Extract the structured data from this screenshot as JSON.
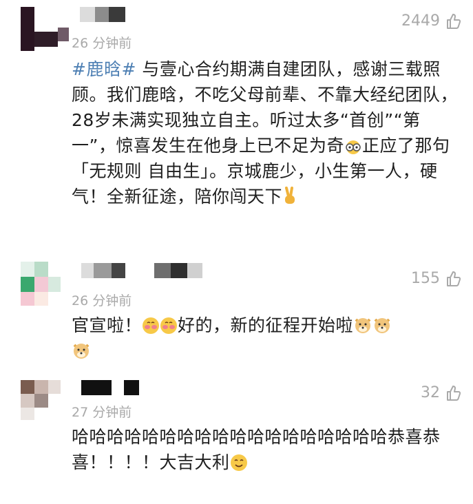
{
  "comments": [
    {
      "time": "26 分钟前",
      "likes": "2449",
      "hashtag": "#鹿晗#",
      "text": " 与壹心合约期满自建团队，感谢三载照顾。我们鹿晗，不吃父母前辈、不靠大经纪团队，28岁未满实现独立自主。听过太多“首创”“第一”，惊喜发生在他身上已不足为奇",
      "text2": "正应了那句「无规则 自由生」。京城鹿少，小生第一人，硬气！全新征途，陪你闯天下",
      "emojis": [
        "glasses-emoji",
        "victory-hand-emoji"
      ]
    },
    {
      "time": "26 分钟前",
      "likes": "155",
      "text": "官宣啦！",
      "text2": "好的，新的征程开始啦",
      "emojis": [
        "blush-emoji",
        "blush-emoji",
        "doge-emoji",
        "doge-emoji",
        "doge-emoji"
      ]
    },
    {
      "time": "27 分钟前",
      "likes": "32",
      "text": "哈哈哈哈哈哈哈哈哈哈哈哈哈哈哈哈哈哈恭喜恭喜！！！！大吉大利",
      "emojis": [
        "smile-emoji"
      ]
    }
  ],
  "icons": {
    "like": "thumbs-up-icon"
  },
  "colors": {
    "meta": "#a9a9a9",
    "hashtag": "#4d7fb3",
    "text": "#1f1f1f"
  }
}
